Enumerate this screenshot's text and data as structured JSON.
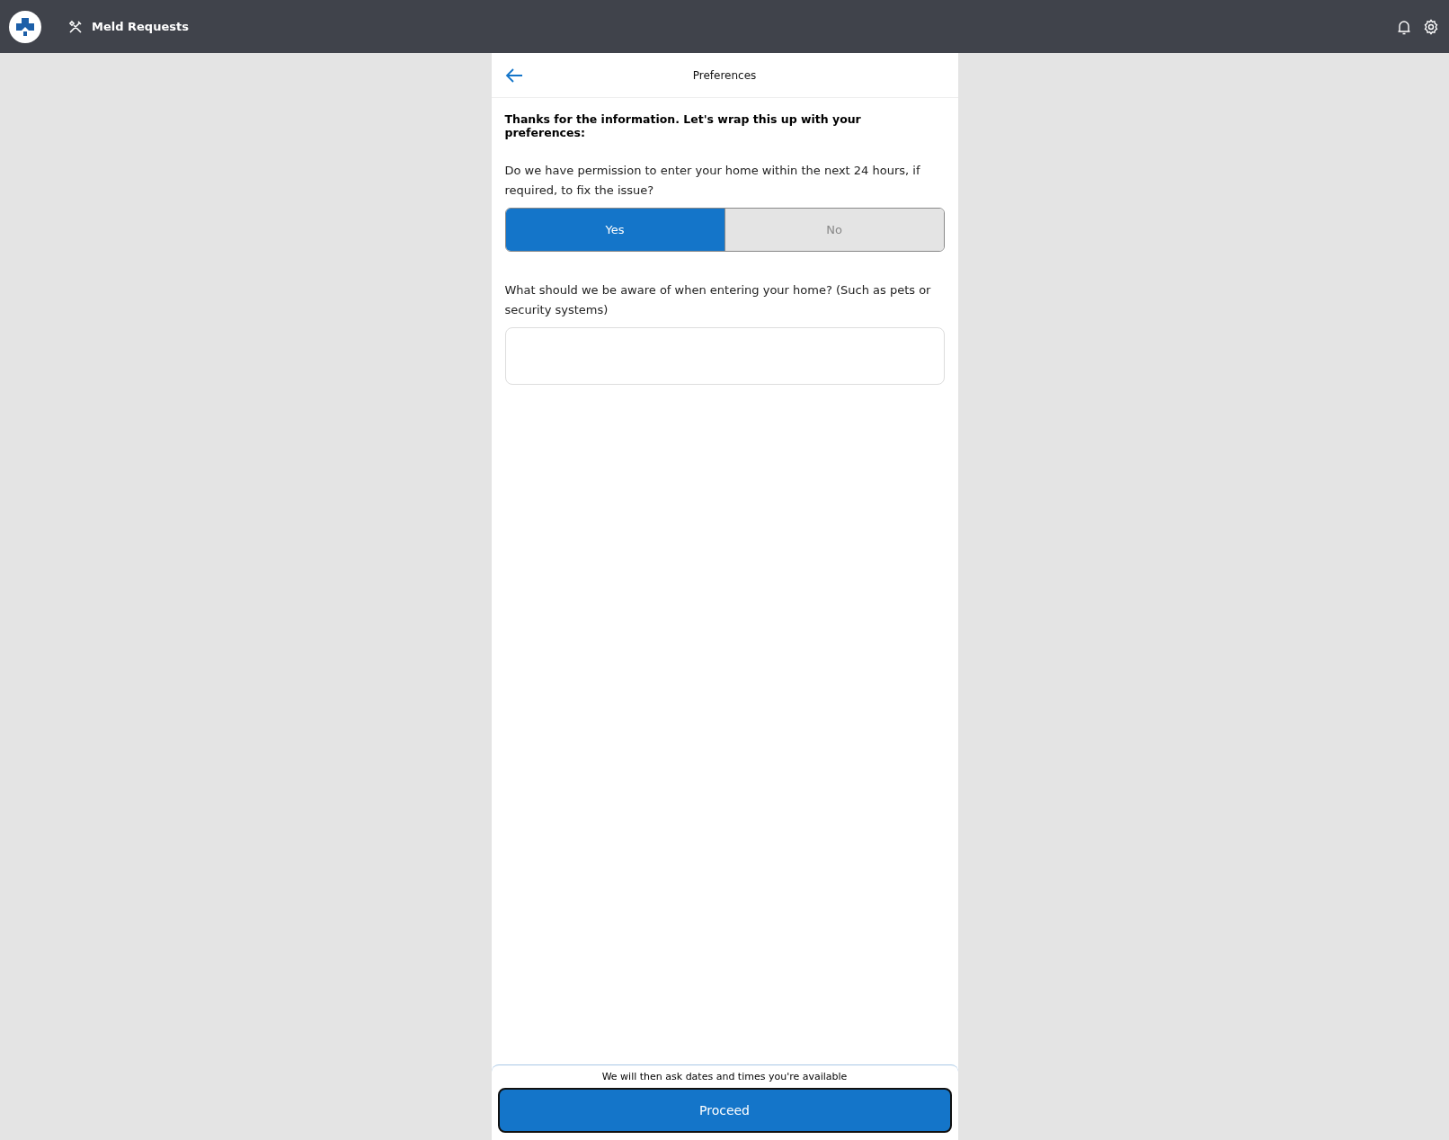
{
  "app_bar": {
    "title": "Meld Requests"
  },
  "page": {
    "title": "Preferences",
    "intro": "Thanks for the information. Let's wrap this up with your preferences:",
    "permission": {
      "question": "Do we have permission to enter your home within the next 24 hours, if required, to fix the issue?",
      "options": [
        {
          "label": "Yes",
          "selected": true
        },
        {
          "label": "No",
          "selected": false
        }
      ]
    },
    "notes": {
      "question": "What should we be aware of when entering your home? (Such as pets or security systems)"
    }
  },
  "footer": {
    "hint": "We will then ask dates and times you're available",
    "button": "Proceed"
  }
}
